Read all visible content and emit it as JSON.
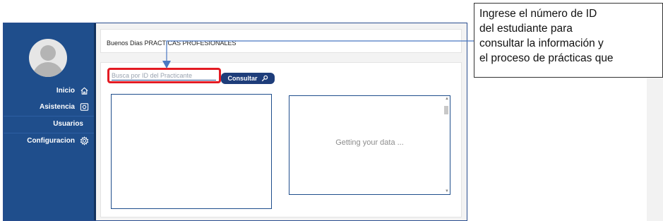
{
  "sidebar": {
    "items": [
      {
        "label": "Inicio",
        "icon": "home-icon"
      },
      {
        "label": "Asistencia",
        "icon": "camera-icon"
      },
      {
        "label": "Usuarios",
        "icon": ""
      },
      {
        "label": "Configuracion",
        "icon": "gear-icon"
      }
    ],
    "colors": {
      "background": "#1f4e8c",
      "text": "#ffffff"
    }
  },
  "header": {
    "greeting": "Buenos Dias PRACTICAS PROFESIONALES"
  },
  "search": {
    "placeholder": "Busca por ID del Practicante",
    "value": "",
    "button_label": "Consultar",
    "button_icon": "search-icon"
  },
  "panels": {
    "right_status": "Getting your data ..."
  },
  "callout": {
    "lines": [
      "Ingrese el número de ID",
      "del estudiante para",
      "consultar la información y",
      "el proceso de prácticas que"
    ]
  },
  "colors": {
    "highlight": "#e31b23",
    "accent": "#1e3d7a"
  }
}
